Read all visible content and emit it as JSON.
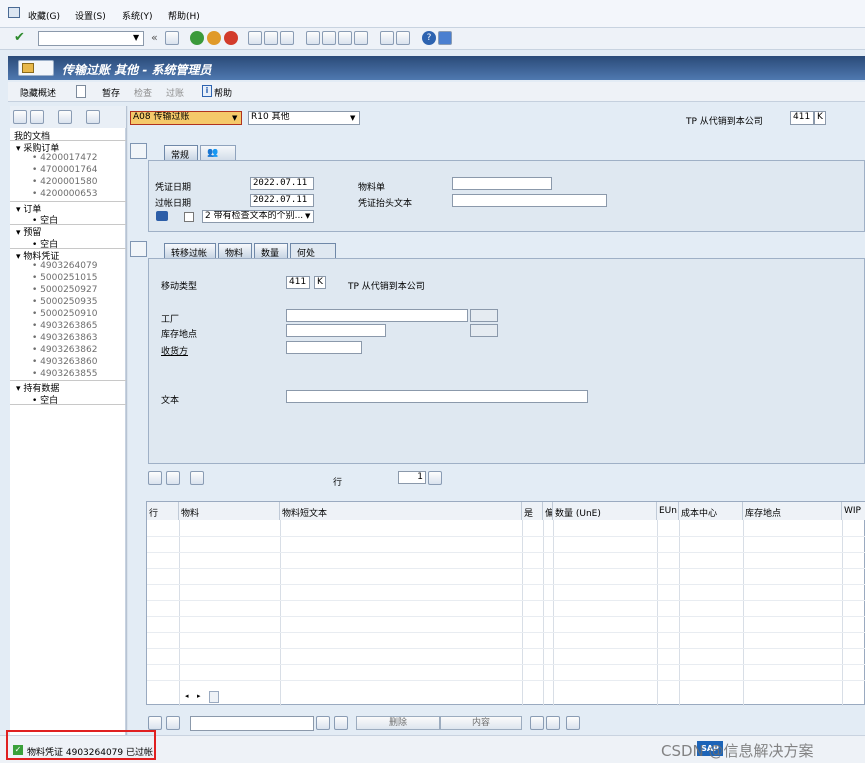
{
  "menu": {
    "items": [
      "收藏(G)",
      "设置(S)",
      "系统(Y)",
      "帮助(H)"
    ]
  },
  "title": "传输过账 其他 - 系统管理员",
  "appbar": {
    "hide_overview": "隐藏概述",
    "hold": "暂存",
    "check": "检查",
    "post": "过账",
    "help": "帮助"
  },
  "tree": {
    "root": "我的文档",
    "purchase_orders": {
      "label": "采购订单",
      "items": [
        "4200017472",
        "4700001764",
        "4200001580",
        "4200000653"
      ]
    },
    "orders": {
      "label": "订单",
      "items": [
        "空白"
      ]
    },
    "reservations": {
      "label": "预留",
      "items": [
        "空白"
      ]
    },
    "material_docs": {
      "label": "物料凭证",
      "items": [
        "4903264079",
        "5000251015",
        "5000250927",
        "5000250935",
        "5000250910",
        "4903263865",
        "4903263863",
        "4903263862",
        "4903263860",
        "4903263855"
      ]
    },
    "held_data": {
      "label": "持有数据",
      "items": [
        "空白"
      ]
    }
  },
  "header": {
    "transaction": "A08 传输过账",
    "reference": "R10 其他",
    "movement_text": "TP 从代销到本公司",
    "movement_type": "411",
    "special_stock": "K"
  },
  "tabs_top": [
    "常规"
  ],
  "general": {
    "doc_date_label": "凭证日期",
    "doc_date": "2022.07.11",
    "post_date_label": "过帐日期",
    "post_date": "2022.07.11",
    "material_slip_label": "物料单",
    "header_text_label": "凭证抬头文本",
    "print_option": "2 带有检查文本的个别..."
  },
  "tabs_item": [
    "转移过帐",
    "物料",
    "数量",
    "何处"
  ],
  "item": {
    "movement_type_label": "移动类型",
    "movement_type": "411",
    "special_stock": "K",
    "movement_text": "TP 从代销到本公司",
    "plant_label": "工厂",
    "sloc_label": "库存地点",
    "recipient_label": "收货方",
    "text_label": "文本"
  },
  "line": {
    "label": "行",
    "value": "1"
  },
  "grid": {
    "columns": [
      "行",
      "物料",
      "物料短文本",
      "是",
      "偏",
      "数量 (UnE)",
      "EUn",
      "成本中心",
      "库存地点",
      "WIP"
    ]
  },
  "grid_buttons": {
    "delete": "删除",
    "content": "内容"
  },
  "status": {
    "message": "物料凭证 4903264079 已过帐"
  },
  "watermark": "CSDN @信息解决方案",
  "colors": {
    "title_bg": "#2a4a78",
    "highlight": "#f5c96a",
    "status_box": "#e02020"
  }
}
